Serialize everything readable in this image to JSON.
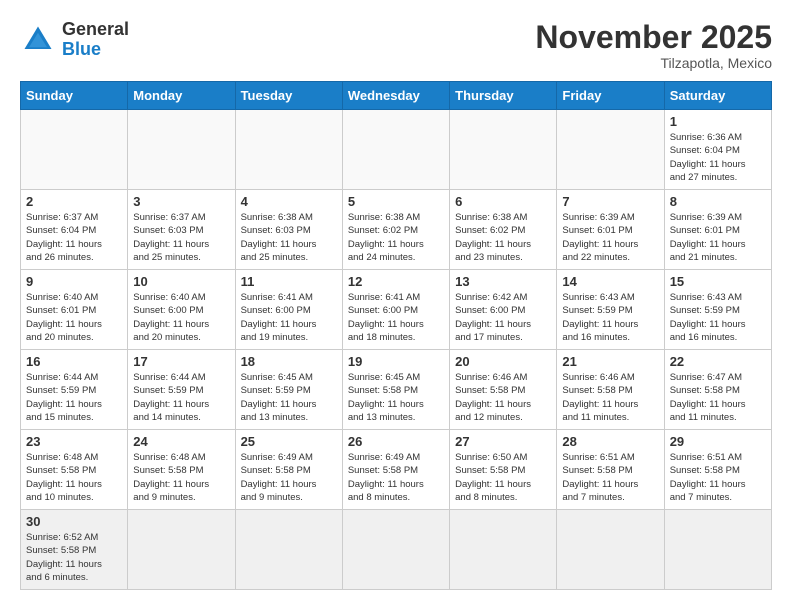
{
  "header": {
    "logo_general": "General",
    "logo_blue": "Blue",
    "month_title": "November 2025",
    "subtitle": "Tilzapotla, Mexico"
  },
  "weekdays": [
    "Sunday",
    "Monday",
    "Tuesday",
    "Wednesday",
    "Thursday",
    "Friday",
    "Saturday"
  ],
  "weeks": [
    [
      {
        "day": "",
        "info": ""
      },
      {
        "day": "",
        "info": ""
      },
      {
        "day": "",
        "info": ""
      },
      {
        "day": "",
        "info": ""
      },
      {
        "day": "",
        "info": ""
      },
      {
        "day": "",
        "info": ""
      },
      {
        "day": "1",
        "info": "Sunrise: 6:36 AM\nSunset: 6:04 PM\nDaylight: 11 hours\nand 27 minutes."
      }
    ],
    [
      {
        "day": "2",
        "info": "Sunrise: 6:37 AM\nSunset: 6:04 PM\nDaylight: 11 hours\nand 26 minutes."
      },
      {
        "day": "3",
        "info": "Sunrise: 6:37 AM\nSunset: 6:03 PM\nDaylight: 11 hours\nand 25 minutes."
      },
      {
        "day": "4",
        "info": "Sunrise: 6:38 AM\nSunset: 6:03 PM\nDaylight: 11 hours\nand 25 minutes."
      },
      {
        "day": "5",
        "info": "Sunrise: 6:38 AM\nSunset: 6:02 PM\nDaylight: 11 hours\nand 24 minutes."
      },
      {
        "day": "6",
        "info": "Sunrise: 6:38 AM\nSunset: 6:02 PM\nDaylight: 11 hours\nand 23 minutes."
      },
      {
        "day": "7",
        "info": "Sunrise: 6:39 AM\nSunset: 6:01 PM\nDaylight: 11 hours\nand 22 minutes."
      },
      {
        "day": "8",
        "info": "Sunrise: 6:39 AM\nSunset: 6:01 PM\nDaylight: 11 hours\nand 21 minutes."
      }
    ],
    [
      {
        "day": "9",
        "info": "Sunrise: 6:40 AM\nSunset: 6:01 PM\nDaylight: 11 hours\nand 20 minutes."
      },
      {
        "day": "10",
        "info": "Sunrise: 6:40 AM\nSunset: 6:00 PM\nDaylight: 11 hours\nand 20 minutes."
      },
      {
        "day": "11",
        "info": "Sunrise: 6:41 AM\nSunset: 6:00 PM\nDaylight: 11 hours\nand 19 minutes."
      },
      {
        "day": "12",
        "info": "Sunrise: 6:41 AM\nSunset: 6:00 PM\nDaylight: 11 hours\nand 18 minutes."
      },
      {
        "day": "13",
        "info": "Sunrise: 6:42 AM\nSunset: 6:00 PM\nDaylight: 11 hours\nand 17 minutes."
      },
      {
        "day": "14",
        "info": "Sunrise: 6:43 AM\nSunset: 5:59 PM\nDaylight: 11 hours\nand 16 minutes."
      },
      {
        "day": "15",
        "info": "Sunrise: 6:43 AM\nSunset: 5:59 PM\nDaylight: 11 hours\nand 16 minutes."
      }
    ],
    [
      {
        "day": "16",
        "info": "Sunrise: 6:44 AM\nSunset: 5:59 PM\nDaylight: 11 hours\nand 15 minutes."
      },
      {
        "day": "17",
        "info": "Sunrise: 6:44 AM\nSunset: 5:59 PM\nDaylight: 11 hours\nand 14 minutes."
      },
      {
        "day": "18",
        "info": "Sunrise: 6:45 AM\nSunset: 5:59 PM\nDaylight: 11 hours\nand 13 minutes."
      },
      {
        "day": "19",
        "info": "Sunrise: 6:45 AM\nSunset: 5:58 PM\nDaylight: 11 hours\nand 13 minutes."
      },
      {
        "day": "20",
        "info": "Sunrise: 6:46 AM\nSunset: 5:58 PM\nDaylight: 11 hours\nand 12 minutes."
      },
      {
        "day": "21",
        "info": "Sunrise: 6:46 AM\nSunset: 5:58 PM\nDaylight: 11 hours\nand 11 minutes."
      },
      {
        "day": "22",
        "info": "Sunrise: 6:47 AM\nSunset: 5:58 PM\nDaylight: 11 hours\nand 11 minutes."
      }
    ],
    [
      {
        "day": "23",
        "info": "Sunrise: 6:48 AM\nSunset: 5:58 PM\nDaylight: 11 hours\nand 10 minutes."
      },
      {
        "day": "24",
        "info": "Sunrise: 6:48 AM\nSunset: 5:58 PM\nDaylight: 11 hours\nand 9 minutes."
      },
      {
        "day": "25",
        "info": "Sunrise: 6:49 AM\nSunset: 5:58 PM\nDaylight: 11 hours\nand 9 minutes."
      },
      {
        "day": "26",
        "info": "Sunrise: 6:49 AM\nSunset: 5:58 PM\nDaylight: 11 hours\nand 8 minutes."
      },
      {
        "day": "27",
        "info": "Sunrise: 6:50 AM\nSunset: 5:58 PM\nDaylight: 11 hours\nand 8 minutes."
      },
      {
        "day": "28",
        "info": "Sunrise: 6:51 AM\nSunset: 5:58 PM\nDaylight: 11 hours\nand 7 minutes."
      },
      {
        "day": "29",
        "info": "Sunrise: 6:51 AM\nSunset: 5:58 PM\nDaylight: 11 hours\nand 7 minutes."
      }
    ],
    [
      {
        "day": "30",
        "info": "Sunrise: 6:52 AM\nSunset: 5:58 PM\nDaylight: 11 hours\nand 6 minutes."
      },
      {
        "day": "",
        "info": ""
      },
      {
        "day": "",
        "info": ""
      },
      {
        "day": "",
        "info": ""
      },
      {
        "day": "",
        "info": ""
      },
      {
        "day": "",
        "info": ""
      },
      {
        "day": "",
        "info": ""
      }
    ]
  ]
}
